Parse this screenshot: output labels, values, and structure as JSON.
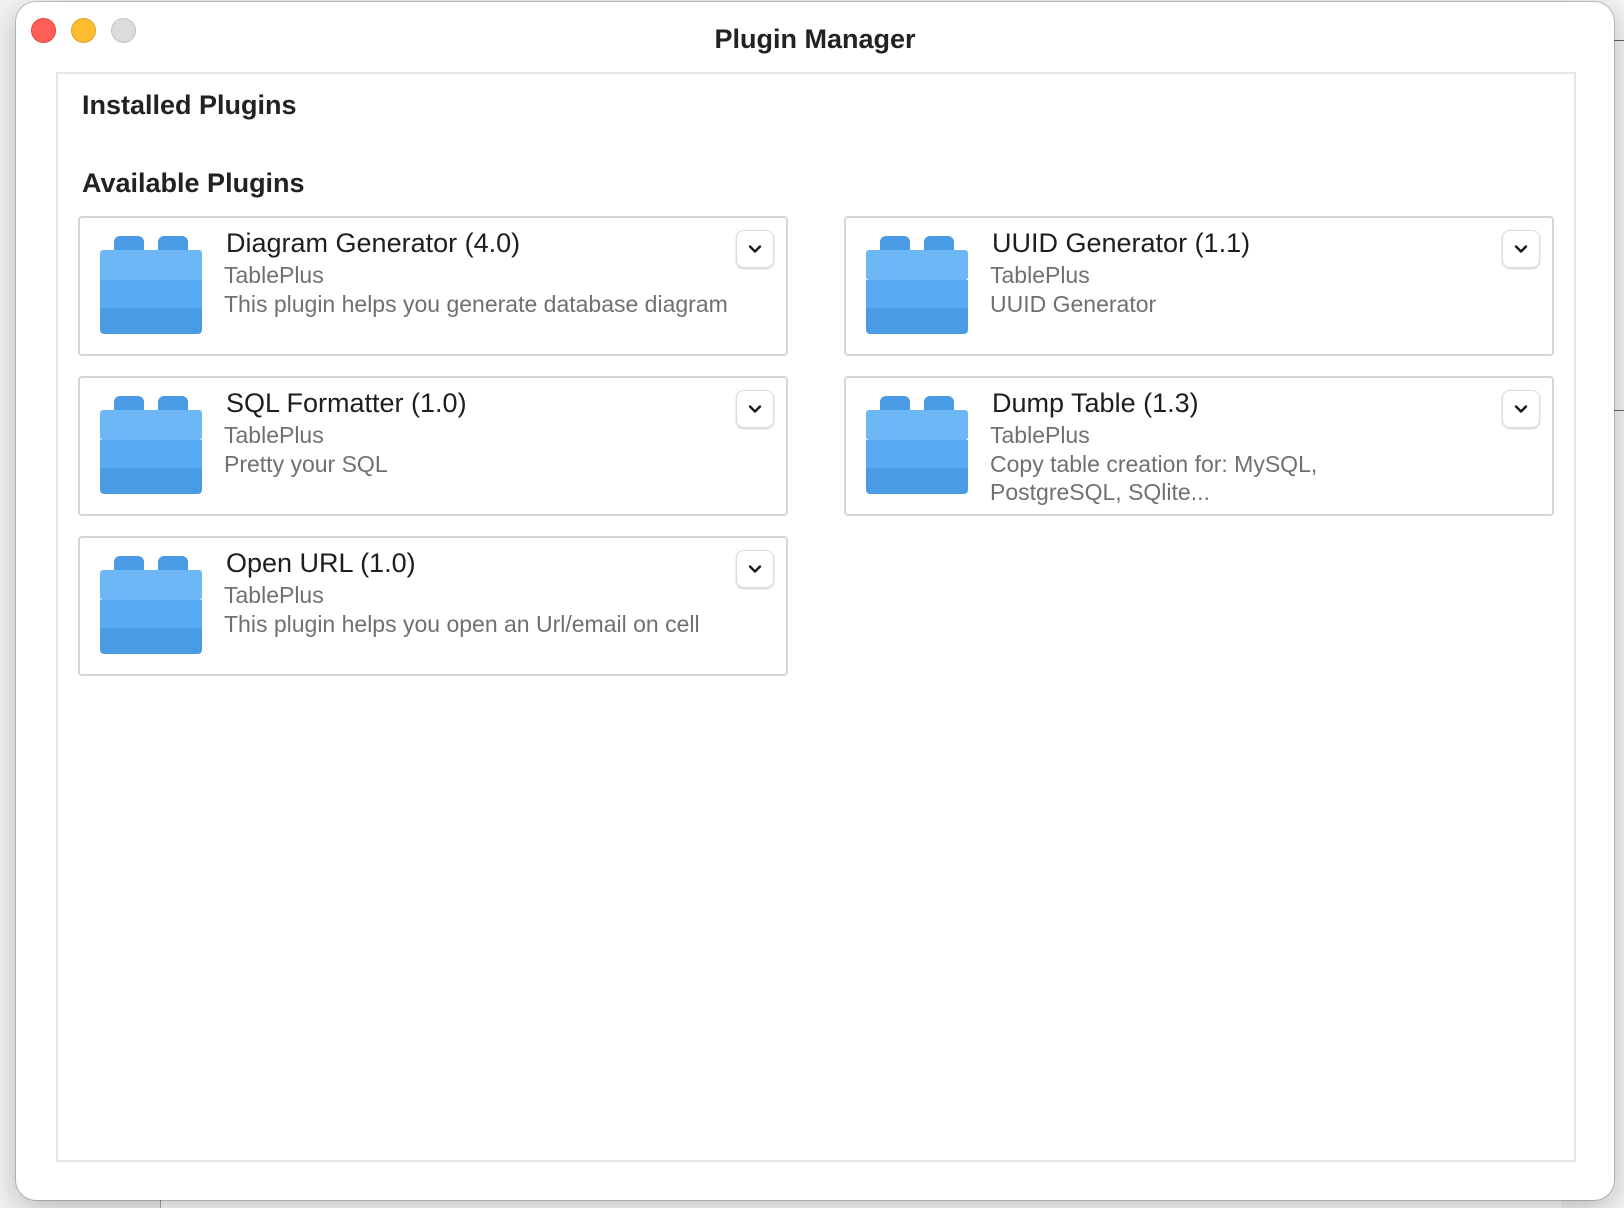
{
  "window": {
    "title": "Plugin Manager"
  },
  "sections": {
    "installed_title": "Installed Plugins",
    "available_title": "Available Plugins"
  },
  "plugins": [
    {
      "name": "Diagram Generator (4.0)",
      "author": "TablePlus",
      "description": "This plugin helps you generate database diagram"
    },
    {
      "name": "UUID Generator (1.1)",
      "author": "TablePlus",
      "description": "UUID Generator"
    },
    {
      "name": "SQL Formatter (1.0)",
      "author": "TablePlus",
      "description": "Pretty your SQL"
    },
    {
      "name": "Dump Table (1.3)",
      "author": "TablePlus",
      "description": "Copy table creation for: MySQL, PostgreSQL, SQlite..."
    },
    {
      "name": "Open URL (1.0)",
      "author": "TablePlus",
      "description": "This plugin helps you open an Url/email on cell"
    }
  ],
  "icons": {
    "plugin": "plugin-block-icon",
    "expand": "chevron-down-icon"
  },
  "colors": {
    "close": "#ff5f57",
    "minimize": "#febc2e",
    "zoom": "#dcdcdc",
    "plugin_icon_light": "#6db7f7",
    "plugin_icon_mid": "#57a9f3",
    "plugin_icon_dark": "#4a9be6"
  }
}
